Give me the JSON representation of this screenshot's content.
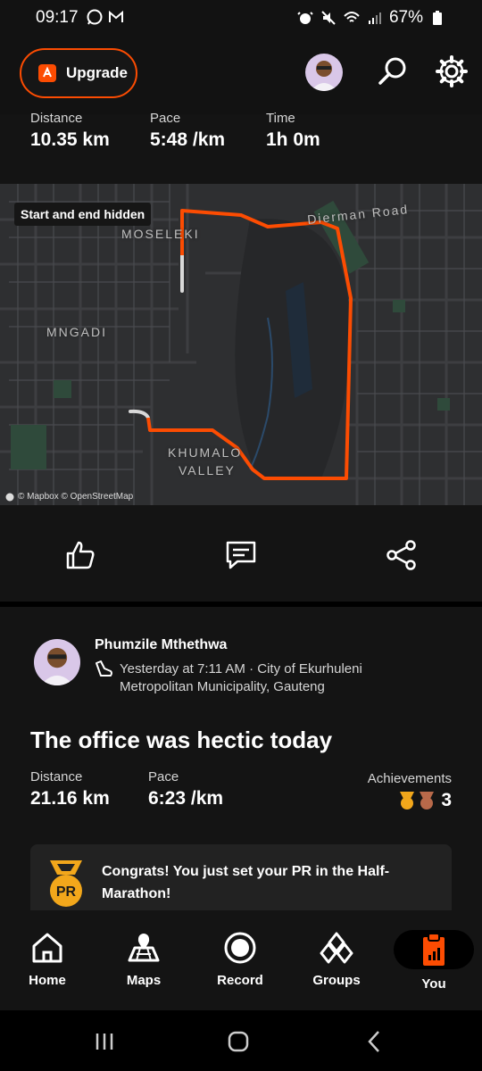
{
  "status_bar": {
    "time": "09:17",
    "battery": "67%"
  },
  "topbar": {
    "upgrade_label": "Upgrade"
  },
  "activity1": {
    "stats": [
      {
        "label": "Distance",
        "value": "10.35 km"
      },
      {
        "label": "Pace",
        "value": "5:48 /km"
      },
      {
        "label": "Time",
        "value": "1h 0m"
      }
    ],
    "map": {
      "badge": "Start and end hidden",
      "attribution": "© Mapbox © OpenStreetMap",
      "labels": {
        "road": "Dierman Road",
        "area1": "MOSELEKI",
        "area2": "MNGADI",
        "area3_line1": "KHUMALO",
        "area3_line2": "VALLEY"
      }
    }
  },
  "activity2": {
    "athlete": "Phumzile Mthethwa",
    "meta_line1": "Yesterday at 7:11 AM · City of Ekurhuleni",
    "meta_line2": "Metropolitan Municipality, Gauteng",
    "title": "The office was hectic today",
    "stats": [
      {
        "label": "Distance",
        "value": "21.16 km"
      },
      {
        "label": "Pace",
        "value": "6:23 /km"
      }
    ],
    "achievements": {
      "label": "Achievements",
      "count": "3"
    },
    "pr": {
      "badge": "PR",
      "text": "Congrats! You just set your PR in the Half-Marathon!"
    }
  },
  "tabs": [
    {
      "label": "Home",
      "icon": "home-icon"
    },
    {
      "label": "Maps",
      "icon": "map-icon"
    },
    {
      "label": "Record",
      "icon": "record-icon"
    },
    {
      "label": "Groups",
      "icon": "groups-icon"
    },
    {
      "label": "You",
      "icon": "you-icon",
      "active": true
    }
  ],
  "colors": {
    "accent": "#fc4c02",
    "background": "#141414",
    "gold": "#f2a71b",
    "bronze": "#b8694a"
  }
}
